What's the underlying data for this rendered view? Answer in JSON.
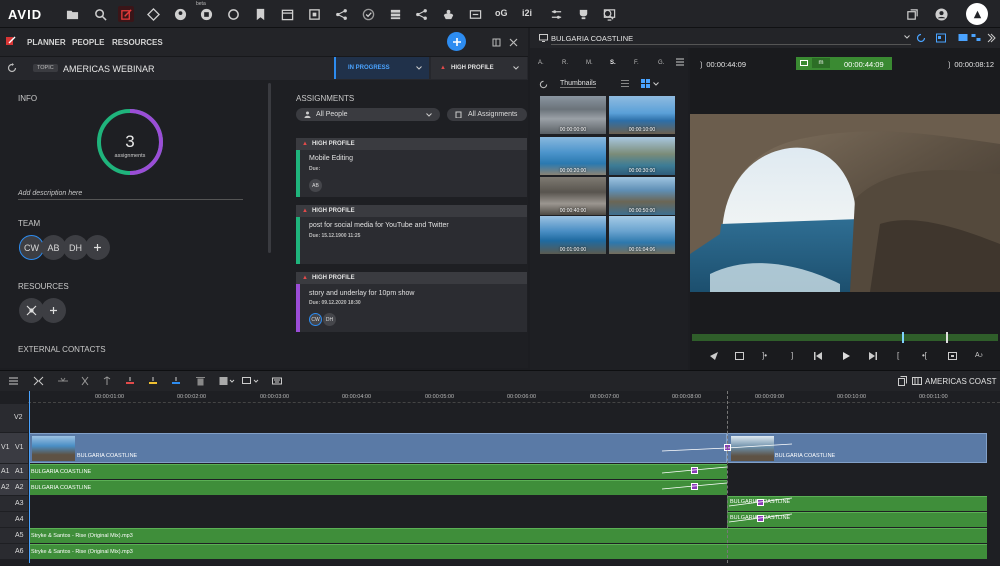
{
  "topbar": {
    "logo": "AVID",
    "beta_badge": "beta",
    "og_label": "oG",
    "i2i_label": "i2i",
    "icons": [
      "folder-icon",
      "search-icon",
      "planner-icon",
      "share-icon",
      "user-circle-icon",
      "beta-tool-icon",
      "chat-icon",
      "bookmark-icon",
      "calendar-icon",
      "network-icon",
      "check-circle-icon",
      "stack-icon",
      "share-alt-icon",
      "hand-icon",
      "tag-icon",
      "trophy-icon",
      "pencil-screen-icon",
      "zoom-icon",
      "windows-icon",
      "user-icon",
      "triangle-logo-icon"
    ]
  },
  "planner": {
    "nav": [
      "PLANNER",
      "PEOPLE",
      "RESOURCES"
    ],
    "topic_badge": "TOPIC",
    "topic_title": "AMERICAS WEBINAR",
    "status": "IN PROGRESS",
    "priority": "HIGH PROFILE",
    "info_label": "INFO",
    "assign_count": "3",
    "assign_word": "assignments",
    "description_placeholder": "Add description here",
    "team_label": "TEAM",
    "team": [
      "CW",
      "AB",
      "DH"
    ],
    "resources_label": "RESOURCES",
    "external_label": "EXTERNAL CONTACTS",
    "assignments_label": "ASSIGNMENTS",
    "filter_people": "All People",
    "filter_assign": "All Assignments",
    "cards": [
      {
        "badge": "HIGH PROFILE",
        "title": "Mobile Editing",
        "due": "Due:",
        "avatars": [
          "AB"
        ],
        "color": "#1fb47c"
      },
      {
        "badge": "HIGH PROFILE",
        "title": "post for social media for YouTube and Twitter",
        "due": "Due: 15.12.1900 11:25",
        "avatars": [],
        "color": "#1fb47c"
      },
      {
        "badge": "HIGH PROFILE",
        "title": "story and underlay for 10pm show",
        "due": "Due: 09.12.2020 18:30",
        "avatars": [
          "CW",
          "DH"
        ],
        "color": "#9b4dd6"
      }
    ],
    "progress_fraction": 0.5
  },
  "bin": {
    "title": "BULGARIA COASTLINE",
    "columns": [
      "A.",
      "R.",
      "M.",
      "S.",
      "F.",
      "G."
    ],
    "view_mode": "Thumbnails",
    "thumbs": [
      "00:00:00:00",
      "00:00:10:00",
      "00:00:20:00",
      "00:00:30:00",
      "00:00:40:00",
      "00:00:50:00",
      "00:01:00:00",
      "00:01:04:06"
    ]
  },
  "viewer": {
    "tc_left": "00:00:44:09",
    "tc_mode": "m",
    "tc_center": "00:00:44:09",
    "tc_right": "00:00:08:12"
  },
  "timeline": {
    "sequence_name": "AMERICAS COAST",
    "ruler": [
      "00:00:01:00",
      "00:00:02:00",
      "00:00:03:00",
      "00:00:04:00",
      "00:00:05:00",
      "00:00:06:00",
      "00:00:07:00",
      "00:00:08:00",
      "00:00:09:00",
      "00:00:10:00",
      "00:00:11:00"
    ],
    "tracks": [
      {
        "src": "",
        "rec": "V2"
      },
      {
        "src": "V1",
        "rec": "V1"
      },
      {
        "src": "A1",
        "rec": "A1"
      },
      {
        "src": "A2",
        "rec": "A2"
      },
      {
        "src": "",
        "rec": "A3"
      },
      {
        "src": "",
        "rec": "A4"
      },
      {
        "src": "",
        "rec": "A5"
      },
      {
        "src": "",
        "rec": "A6"
      }
    ],
    "clips": {
      "v1_a": "BULGARIA COASTLINE",
      "v1_b": "BULGARIA COASTLINE",
      "a1": "BULGARIA COASTLINE",
      "a2": "BULGARIA COASTLINE",
      "a3": "BULGARIA COASTLINE",
      "a4": "BULGARIA COASTLINE",
      "a5": "Stryke & Santos - Rise (Original Mix).mp3",
      "a6": "Stryke & Santos - Rise (Original Mix).mp3"
    }
  }
}
